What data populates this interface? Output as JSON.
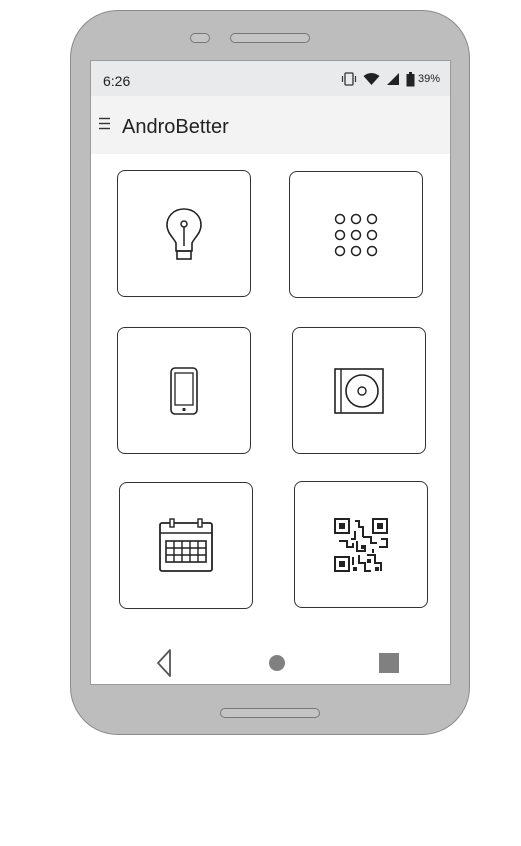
{
  "status_bar": {
    "time": "6:26",
    "battery_percent": "39%",
    "icons": [
      "vibrate-icon",
      "wifi-icon",
      "signal-icon",
      "battery-icon"
    ]
  },
  "app_bar": {
    "title": "AndroBetter",
    "menu_icon": "hamburger-menu-icon"
  },
  "tiles": [
    {
      "icon": "lightbulb-icon"
    },
    {
      "icon": "dialpad-icon"
    },
    {
      "icon": "smartphone-icon"
    },
    {
      "icon": "disc-case-icon"
    },
    {
      "icon": "calendar-icon"
    },
    {
      "icon": "qr-code-icon"
    }
  ],
  "nav_bar": {
    "buttons": [
      "back-icon",
      "home-icon",
      "recents-icon"
    ]
  },
  "colors": {
    "phone_body": "#bdbdbd",
    "status_bar": "#e8eaeb",
    "app_bar": "#f3f3f3",
    "icon_stroke": "#222222",
    "nav_fill": "#808080"
  }
}
